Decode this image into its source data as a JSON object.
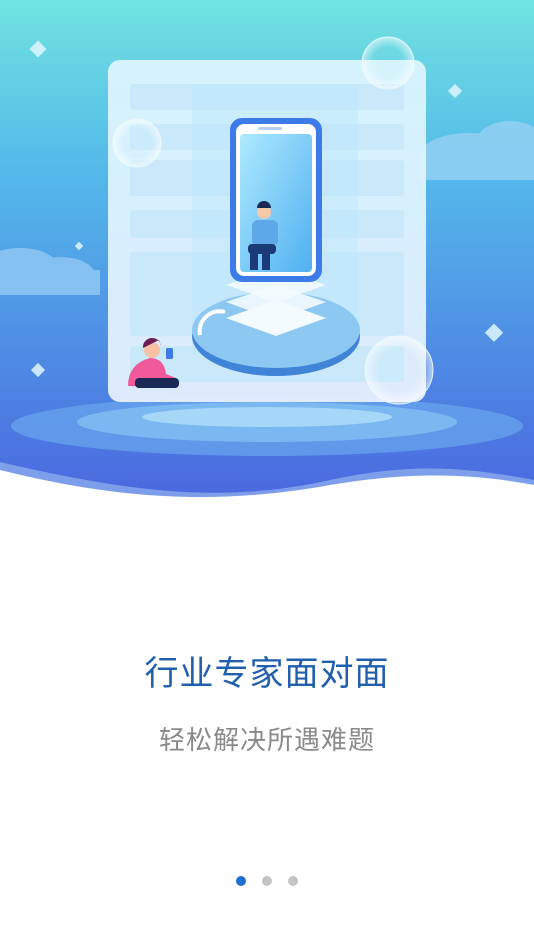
{
  "onboarding": {
    "title": "行业专家面对面",
    "subtitle": "轻松解决所遇难题",
    "current_page": 1,
    "total_pages": 3
  },
  "colors": {
    "accent": "#1f6fd1",
    "title_text": "#1f5fae",
    "subtitle_text": "#8a8a8a",
    "dot_inactive": "#c4c4c4",
    "hero_top": "#6fe0e3",
    "hero_bottom": "#4a6fe0"
  }
}
